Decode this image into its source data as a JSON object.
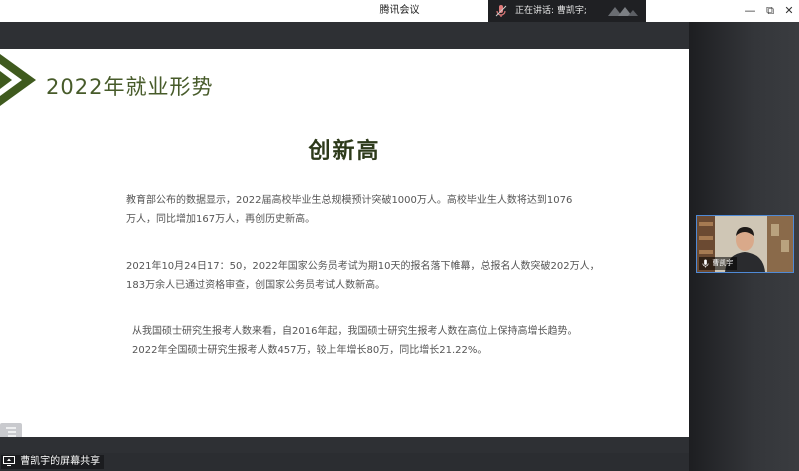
{
  "window": {
    "title": "腾讯会议",
    "speaking_label": "正在讲话: 曹凯宇;",
    "controls": {
      "minimize": "—",
      "restore": "⧉",
      "close": "✕"
    }
  },
  "participant": {
    "name": "曹凯宇"
  },
  "share": {
    "label": "曹凯宇的屏幕共享"
  },
  "slide": {
    "heading": "2022年就业形势",
    "title": "创新高",
    "paragraphs": [
      {
        "lines": [
          "教育部公布的数据显示，2022届高校毕业生总规模预计突破1000万人。高校毕业生人数将达到1076",
          "万人，同比增加167万人，再创历史新高。"
        ]
      },
      {
        "lines": [
          "2021年10月24日17：50，2022年国家公务员考试为期10天的报名落下帷幕，总报名人数突破202万人，",
          "183万余人已通过资格审查，创国家公务员考试人数新高。"
        ]
      },
      {
        "lines": [
          "从我国硕士研究生报考人数来看，自2016年起，我国硕士研究生报考人数在高位上保持高增长趋势。",
          "2022年全国硕士研究生报考人数457万，较上年增长80万，同比增长21.22%。"
        ]
      }
    ]
  },
  "colors": {
    "slide_heading": "#475b2a",
    "slide_title": "#2d3a1a",
    "accent_triangle": "#3f5a1e",
    "dark_chrome": "#2e3034",
    "video_border": "#4f8ad6"
  },
  "icons": [
    "microphone-icon",
    "tencent-meeting-logo-icon",
    "screen-share-icon",
    "toc-list-icon"
  ]
}
